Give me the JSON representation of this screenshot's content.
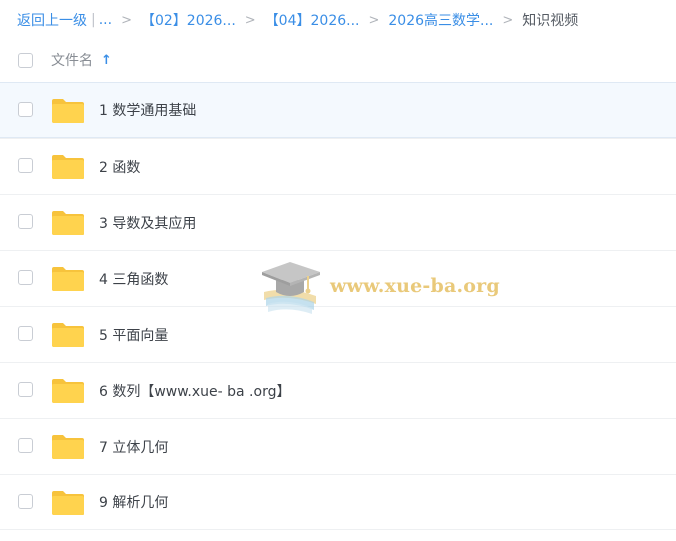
{
  "breadcrumb": {
    "back_label": "返回上一级",
    "pipe": "|",
    "ellipsis": "...",
    "separator": ">",
    "crumb1": "【02】2026...",
    "crumb2": "【04】2026...",
    "crumb3": "2026高三数学...",
    "current": "知识视频"
  },
  "header": {
    "name_label": "文件名",
    "sort_icon": "↑"
  },
  "rows": [
    {
      "label": "1 数学通用基础"
    },
    {
      "label": "2 函数"
    },
    {
      "label": "3 导数及其应用"
    },
    {
      "label": "4 三角函数"
    },
    {
      "label": "5 平面向量"
    },
    {
      "label": "6 数列【www.xue- ba .org】"
    },
    {
      "label": "7 立体几何"
    },
    {
      "label": "9 解析几何"
    }
  ],
  "watermark": {
    "text": "www.xue-ba.org"
  },
  "colors": {
    "accent": "#3a8ee6",
    "folder": "#ffd34e",
    "selected_row": "#f4f9fe"
  }
}
